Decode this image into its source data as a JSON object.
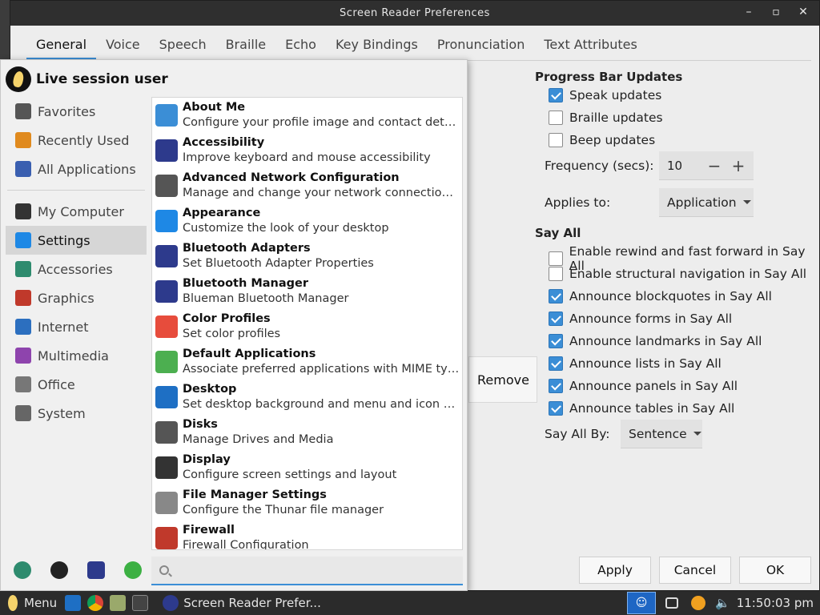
{
  "window": {
    "title": "Screen Reader Preferences",
    "tabs": [
      "General",
      "Voice",
      "Speech",
      "Braille",
      "Echo",
      "Key Bindings",
      "Pronunciation",
      "Text Attributes"
    ],
    "active_tab": "General"
  },
  "progress": {
    "header": "Progress Bar Updates",
    "speak": "Speak updates",
    "braille": "Braille updates",
    "beep": "Beep updates",
    "frequency_label": "Frequency (secs):",
    "frequency_value": "10",
    "applies_label": "Applies to:",
    "applies_value": "Application"
  },
  "sayall": {
    "header": "Say All",
    "items": [
      {
        "label": "Enable rewind and fast forward in Say All",
        "checked": false
      },
      {
        "label": "Enable structural navigation in Say All",
        "checked": false
      },
      {
        "label": "Announce blockquotes in Say All",
        "checked": true
      },
      {
        "label": "Announce forms in Say All",
        "checked": true
      },
      {
        "label": "Announce landmarks in Say All",
        "checked": true
      },
      {
        "label": "Announce lists in Say All",
        "checked": true
      },
      {
        "label": "Announce panels in Say All",
        "checked": true
      },
      {
        "label": "Announce tables in Say All",
        "checked": true
      }
    ],
    "by_label": "Say All By:",
    "by_value": "Sentence"
  },
  "buttons": {
    "remove": "Remove",
    "apply": "Apply",
    "cancel": "Cancel",
    "ok": "OK"
  },
  "menu": {
    "user": "Live session user",
    "categories": [
      {
        "label": "Favorites",
        "icon": "bookmark-icon",
        "color": "#555555"
      },
      {
        "label": "Recently Used",
        "icon": "clock-icon",
        "color": "#e08a1e"
      },
      {
        "label": "All Applications",
        "icon": "grid-icon",
        "color": "#3a5fb0"
      },
      {
        "label": "My Computer",
        "icon": "monitor-icon",
        "color": "#333333"
      },
      {
        "label": "Settings",
        "icon": "settings-icon",
        "color": "#1e88e5"
      },
      {
        "label": "Accessories",
        "icon": "accessories-icon",
        "color": "#2e8b6e"
      },
      {
        "label": "Graphics",
        "icon": "graphics-icon",
        "color": "#c0392b"
      },
      {
        "label": "Internet",
        "icon": "internet-icon",
        "color": "#2c6fbf"
      },
      {
        "label": "Multimedia",
        "icon": "multimedia-icon",
        "color": "#8e44ad"
      },
      {
        "label": "Office",
        "icon": "office-icon",
        "color": "#777777"
      },
      {
        "label": "System",
        "icon": "system-icon",
        "color": "#666666"
      }
    ],
    "active_category": "Settings",
    "apps": [
      {
        "name": "About Me",
        "desc": "Configure your profile image and contact details",
        "icon": "user-icon",
        "color": "#3b8ed6"
      },
      {
        "name": "Accessibility",
        "desc": "Improve keyboard and mouse accessibility",
        "icon": "accessibility-icon",
        "color": "#2d3a8c"
      },
      {
        "name": "Advanced Network Configuration",
        "desc": "Manage and change your network connection settings",
        "icon": "network-icon",
        "color": "#555555"
      },
      {
        "name": "Appearance",
        "desc": "Customize the look of your desktop",
        "icon": "appearance-icon",
        "color": "#1e88e5"
      },
      {
        "name": "Bluetooth Adapters",
        "desc": "Set Bluetooth Adapter Properties",
        "icon": "bluetooth-icon",
        "color": "#2d3a8c"
      },
      {
        "name": "Bluetooth Manager",
        "desc": "Blueman Bluetooth Manager",
        "icon": "bluetooth-icon",
        "color": "#2d3a8c"
      },
      {
        "name": "Color Profiles",
        "desc": "Set color profiles",
        "icon": "color-profiles-icon",
        "color": "#e74c3c"
      },
      {
        "name": "Default Applications",
        "desc": "Associate preferred applications with MIME types",
        "icon": "default-apps-icon",
        "color": "#4caf50"
      },
      {
        "name": "Desktop",
        "desc": "Set desktop background and menu and icon behavior",
        "icon": "desktop-icon",
        "color": "#1e6fc4"
      },
      {
        "name": "Disks",
        "desc": "Manage Drives and Media",
        "icon": "disks-icon",
        "color": "#555555"
      },
      {
        "name": "Display",
        "desc": "Configure screen settings and layout",
        "icon": "display-icon",
        "color": "#333333"
      },
      {
        "name": "File Manager Settings",
        "desc": "Configure the Thunar file manager",
        "icon": "file-manager-icon",
        "color": "#888888"
      },
      {
        "name": "Firewall",
        "desc": "Firewall Configuration",
        "icon": "firewall-icon",
        "color": "#c0392b"
      }
    ],
    "search_placeholder": ""
  },
  "taskbar": {
    "menu_label": "Menu",
    "task_label": "Screen Reader Prefer...",
    "clock": "11:50:03 pm"
  }
}
